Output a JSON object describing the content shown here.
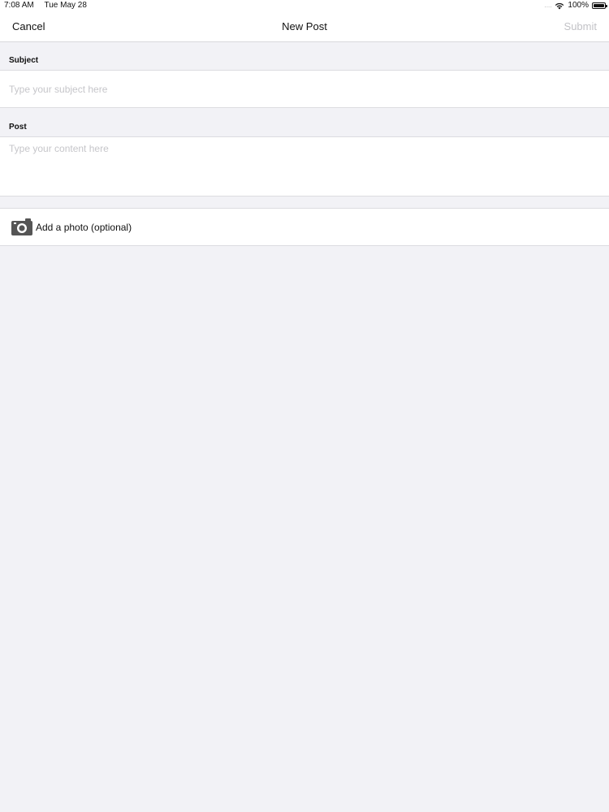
{
  "status_bar": {
    "time": "7:08 AM",
    "date": "Tue May 28",
    "signal": "....",
    "battery": "100%",
    "icons": [
      "wifi-icon",
      "battery-icon"
    ]
  },
  "nav": {
    "cancel_label": "Cancel",
    "title": "New Post",
    "submit_label": "Submit"
  },
  "form": {
    "subject": {
      "label": "Subject",
      "value": "",
      "placeholder": "Type your subject here"
    },
    "post": {
      "label": "Post",
      "value": "",
      "placeholder": "Type your content here"
    },
    "photo": {
      "label": "Add a photo (optional)",
      "icon": "camera-icon"
    }
  },
  "colors": {
    "background": "#f2f2f6",
    "surface": "#ffffff",
    "disabled_text": "#c2c2c6",
    "placeholder": "#c6c6ca"
  }
}
